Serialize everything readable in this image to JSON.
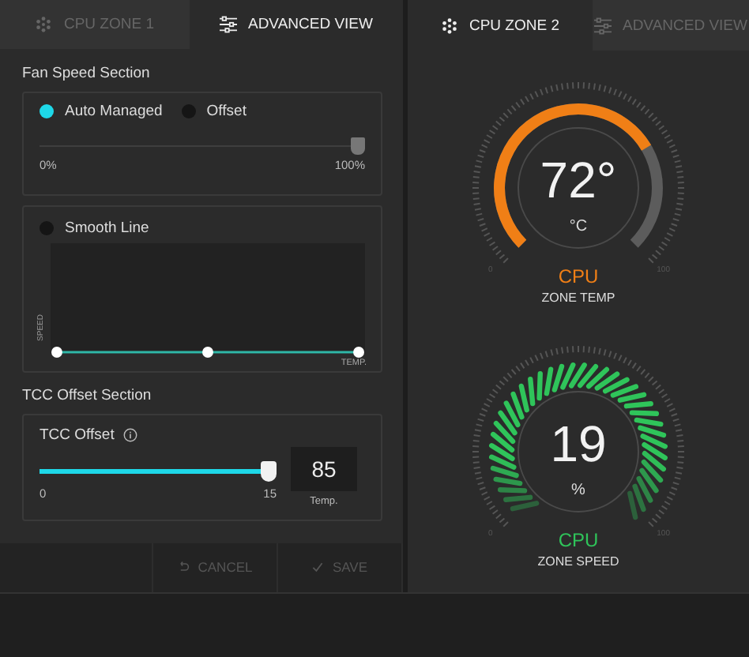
{
  "left_panel": {
    "tabs": [
      {
        "label": "CPU ZONE 1",
        "selected": false
      },
      {
        "label": "ADVANCED VIEW",
        "selected": true
      }
    ],
    "fan_speed_section": {
      "title": "Fan Speed Section",
      "modes": [
        {
          "label": "Auto Managed",
          "selected": true
        },
        {
          "label": "Offset",
          "selected": false
        }
      ],
      "slider": {
        "level": 1,
        "min_label": "0%",
        "max_label": "100%"
      },
      "curve": {
        "smooth_label": "Smooth Line",
        "smooth_on": false,
        "y_label": "SPEED",
        "x_label": "TEMP."
      }
    },
    "tcc_offset_section": {
      "title": "TCC Offset Section",
      "label": "TCC Offset",
      "slider": {
        "level": 1,
        "min_label": "0",
        "max_label": "15"
      },
      "value": "85",
      "unit": "Temp."
    },
    "buttons": [
      {
        "label": "CANCEL"
      },
      {
        "label": "SAVE"
      }
    ]
  },
  "right_panel": {
    "tabs": [
      {
        "label": "CPU ZONE 2",
        "selected": true
      },
      {
        "label": "ADVANCED VIEW",
        "selected": false
      }
    ],
    "gauges": [
      {
        "kind": "temp",
        "value": "72°",
        "unit": "°C",
        "label": "CPU",
        "caption": "ZONE TEMP",
        "min_label": "0",
        "max_label": "100"
      },
      {
        "kind": "speed",
        "value": "19",
        "unit": "%",
        "label": "CPU",
        "caption": "ZONE SPEED",
        "min_label": "0",
        "max_label": "100"
      }
    ]
  }
}
